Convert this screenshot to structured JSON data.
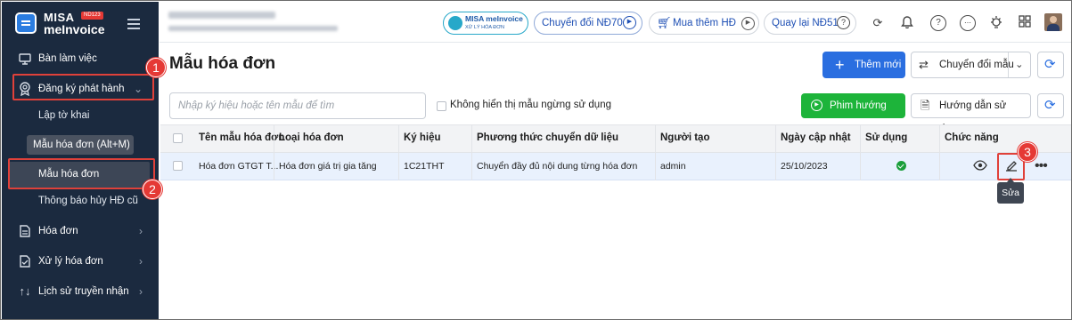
{
  "sidebar": {
    "brand_line1": "MISA",
    "brand_line2": "meInvoice",
    "brand_badge": "ND123",
    "items": [
      {
        "label": "Bàn làm việc",
        "icon": "monitor-icon"
      },
      {
        "label": "Đăng ký phát hành",
        "icon": "register-badge-icon"
      },
      {
        "label": "Hóa đơn",
        "icon": "invoice-icon"
      },
      {
        "label": "Xử lý hóa đơn",
        "icon": "process-invoice-icon"
      },
      {
        "label": "Lịch sử truyền nhận",
        "icon": "transfer-arrows-icon"
      }
    ],
    "sub_items": [
      "Lập tờ khai",
      "Mẫu hóa đơn",
      "Thông báo hủy HĐ cũ"
    ],
    "tooltip": "Mẫu hóa đơn (Alt+M)"
  },
  "header": {
    "misa_pill_line1": "MISA meInvoice",
    "misa_pill_line2": "XỬ LÝ HÓA ĐƠN",
    "convert_pill": "Chuyển đổi NĐ70",
    "buy_more": "Mua thêm HĐ",
    "back_pill": "Quay lại NĐ51"
  },
  "page": {
    "title": "Mẫu hóa đơn",
    "add_button": "Thêm mới",
    "convert_template_button": "Chuyển đổi mẫu",
    "search_placeholder": "Nhập ký hiệu hoặc tên mẫu để tìm",
    "hide_unused_label": "Không hiển thị mẫu ngừng sử dụng",
    "video_button": "Phim hướng dẫn",
    "guide_button": "Hướng dẫn sử dụng"
  },
  "table": {
    "columns": [
      "Tên mẫu hóa đơn",
      "Loại hóa đơn",
      "Ký hiệu",
      "Phương thức chuyển dữ liệu",
      "Người tạo",
      "Ngày cập nhật",
      "Sử dụng",
      "Chức năng"
    ],
    "rows": [
      {
        "name": "Hóa đơn GTGT T...",
        "type": "Hóa đơn giá trị gia tăng",
        "symbol": "1C21THT",
        "method": "Chuyển đầy đủ nội dung từng hóa đơn",
        "creator": "admin",
        "updated": "25/10/2023",
        "in_use": true
      }
    ],
    "edit_tooltip": "Sửa"
  },
  "callouts": [
    "1",
    "2",
    "3"
  ],
  "colors": {
    "sidebar_bg": "#1b2a3f",
    "primary_blue": "#2a6ee0",
    "green": "#1db43a",
    "highlight_red": "#e0413a",
    "row_selected": "#e9f1fd"
  }
}
